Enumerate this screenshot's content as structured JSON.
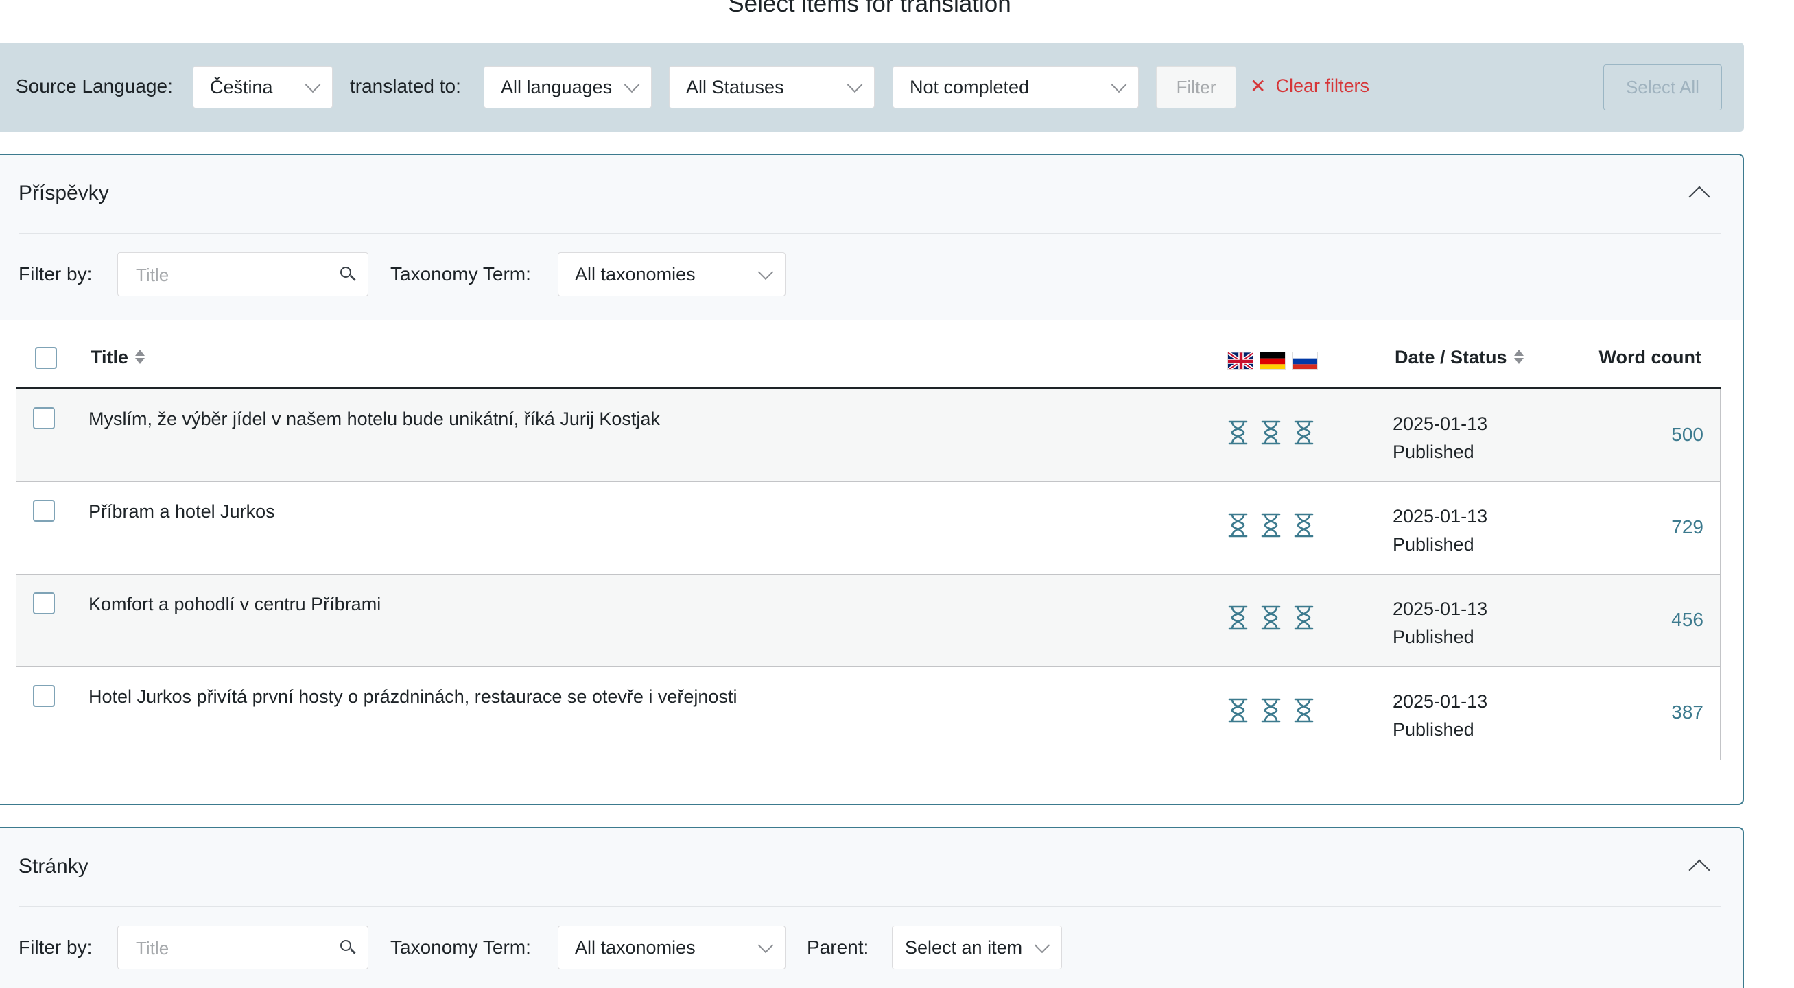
{
  "page": {
    "title": "Select items for translation"
  },
  "filter_bar": {
    "source_language_label": "Source Language:",
    "source_language_value": "Čeština",
    "translated_to_label": "translated to:",
    "target_language_value": "All languages",
    "status_value": "All Statuses",
    "completion_value": "Not completed",
    "filter_button": "Filter",
    "clear_filters": "Clear filters",
    "select_all_button": "Select All"
  },
  "posts_section": {
    "title": "Příspěvky",
    "filter_by_label": "Filter by:",
    "title_placeholder": "Title",
    "taxonomy_label": "Taxonomy Term:",
    "taxonomy_value": "All taxonomies",
    "columns": {
      "title": "Title",
      "date_status": "Date / Status",
      "word_count": "Word count"
    },
    "flags": [
      "flag-uk-icon",
      "flag-de-icon",
      "flag-ru-icon"
    ],
    "rows": [
      {
        "title": "Myslím, že výběr jídel v našem hotelu bude unikátní, říká Jurij Kostjak",
        "date": "2025-01-13",
        "status": "Published",
        "words": "500"
      },
      {
        "title": "Příbram a hotel Jurkos",
        "date": "2025-01-13",
        "status": "Published",
        "words": "729"
      },
      {
        "title": "Komfort a pohodlí v centru Příbrami",
        "date": "2025-01-13",
        "status": "Published",
        "words": "456"
      },
      {
        "title": "Hotel Jurkos přivítá první hosty o prázdninách, restaurace se otevře i veřejnosti",
        "date": "2025-01-13",
        "status": "Published",
        "words": "387"
      }
    ]
  },
  "pages_section": {
    "title": "Stránky",
    "filter_by_label": "Filter by:",
    "title_placeholder": "Title",
    "taxonomy_label": "Taxonomy Term:",
    "taxonomy_value": "All taxonomies",
    "parent_label": "Parent:",
    "parent_value": "Select an item"
  },
  "colors": {
    "accent": "#3c7a8e",
    "filter_bar_bg": "#cfdce2",
    "clear_filters": "#d63638"
  }
}
